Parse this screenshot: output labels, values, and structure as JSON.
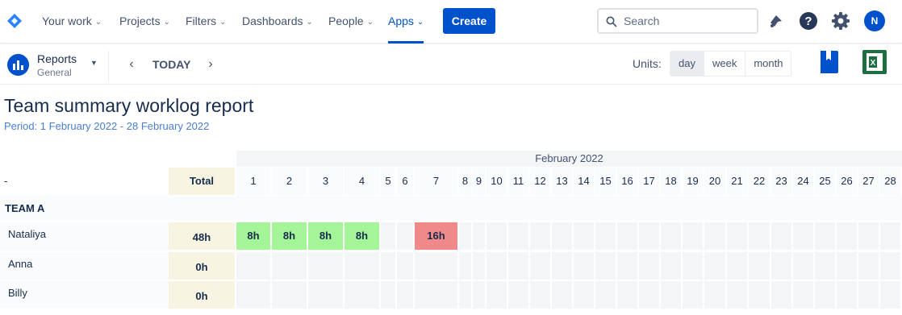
{
  "nav": {
    "items": [
      {
        "label": "Your work"
      },
      {
        "label": "Projects"
      },
      {
        "label": "Filters"
      },
      {
        "label": "Dashboards"
      },
      {
        "label": "People"
      },
      {
        "label": "Apps"
      }
    ],
    "create_label": "Create",
    "search_placeholder": "Search",
    "avatar_initial": "N",
    "accent_color": "#0052cc"
  },
  "subheader": {
    "app_title": "Reports",
    "app_subtitle": "General",
    "today_label": "TODAY",
    "units_label": "Units:",
    "units": [
      "day",
      "week",
      "month"
    ],
    "selected_unit": "day"
  },
  "report": {
    "title": "Team summary worklog report",
    "period": "Period: 1 February 2022 - 28 February 2022",
    "month_label": "February 2022",
    "corner_label": "-",
    "total_label": "Total",
    "days": [
      "1",
      "2",
      "3",
      "4",
      "5",
      "6",
      "7",
      "8",
      "9",
      "10",
      "11",
      "12",
      "13",
      "14",
      "15",
      "16",
      "17",
      "18",
      "19",
      "20",
      "21",
      "22",
      "23",
      "24",
      "25",
      "26",
      "27",
      "28"
    ],
    "team_name": "TEAM A",
    "rows": [
      {
        "name": "Nataliya",
        "total": "48h",
        "entries": {
          "1": "8h",
          "2": "8h",
          "3": "8h",
          "4": "8h",
          "7": "16h"
        }
      },
      {
        "name": "Anna",
        "total": "0h",
        "entries": {}
      },
      {
        "name": "Billy",
        "total": "0h",
        "entries": {}
      }
    ],
    "colors": {
      "normal_day": "#a3f597",
      "overtime_day": "#f08a8a",
      "total_bg": "#f7f4e2"
    }
  }
}
